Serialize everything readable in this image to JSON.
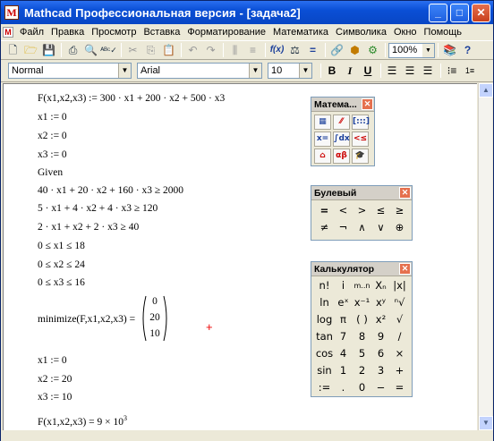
{
  "window": {
    "title": "Mathcad Профессиональная версия - [задача2]",
    "app_icon_glyph": "M"
  },
  "titlebar_buttons": {
    "minimize": "_",
    "maximize": "□",
    "close": "✕"
  },
  "menu": [
    "Файл",
    "Правка",
    "Просмотр",
    "Вставка",
    "Форматирование",
    "Математика",
    "Символика",
    "Окно",
    "Помощь"
  ],
  "toolbar": {
    "zoom_value": "100%",
    "function_label": "f(x)",
    "equals_label": "="
  },
  "formatting": {
    "style": "Normal",
    "font": "Arial",
    "size": "10",
    "bold": "B",
    "italic": "I",
    "underline": "U"
  },
  "worksheet": {
    "lines": [
      "F(x1,x2,x3) := 300 · x1 + 200 · x2 + 500 · x3",
      "x1 := 0",
      "x2 := 0",
      "x3 := 0",
      "Given",
      "40 · x1 + 20 · x2 + 160 · x3 ≥ 2000",
      "5 · x1 + 4 · x2 + 4 · x3 ≥ 120",
      "2 · x1 + x2 + 2 · x3 ≥ 40",
      "0 ≤ x1 ≤ 18",
      "0 ≤ x2 ≤ 24",
      "0 ≤ x3 ≤ 16"
    ],
    "minimize_call": "minimize(F,x1,x2,x3) =",
    "minimize_result": [
      "0",
      "20",
      "10"
    ],
    "results": [
      "x1 := 0",
      "x2 := 20",
      "x3 := 10"
    ],
    "final_prefix": "F(x1,x2,x3) = 9 × 10",
    "final_exponent": "3"
  },
  "panels": {
    "math": {
      "title": "Матема...",
      "buttons": [
        "▦",
        "⁄⁄",
        "[:::]",
        "x=",
        "∫dx",
        "<≤",
        "⌂",
        "αβ",
        "🎓"
      ]
    },
    "boolean": {
      "title": "Булевый",
      "buttons": [
        "=",
        "<",
        ">",
        "≤",
        "≥",
        "≠",
        "¬",
        "∧",
        "∨",
        "⊕"
      ]
    },
    "calculator": {
      "title": "Калькулятор",
      "buttons": [
        "n!",
        "i",
        "m..n",
        "Xₙ",
        "|x|",
        "ln",
        "eˣ",
        "x⁻¹",
        "xʸ",
        "ⁿ√",
        "log",
        "π",
        "( )",
        "x²",
        "√",
        "tan",
        "7",
        "8",
        "9",
        "/",
        "cos",
        "4",
        "5",
        "6",
        "×",
        "sin",
        "1",
        "2",
        "3",
        "+",
        ":=",
        ".",
        "0",
        "−",
        "="
      ]
    }
  }
}
